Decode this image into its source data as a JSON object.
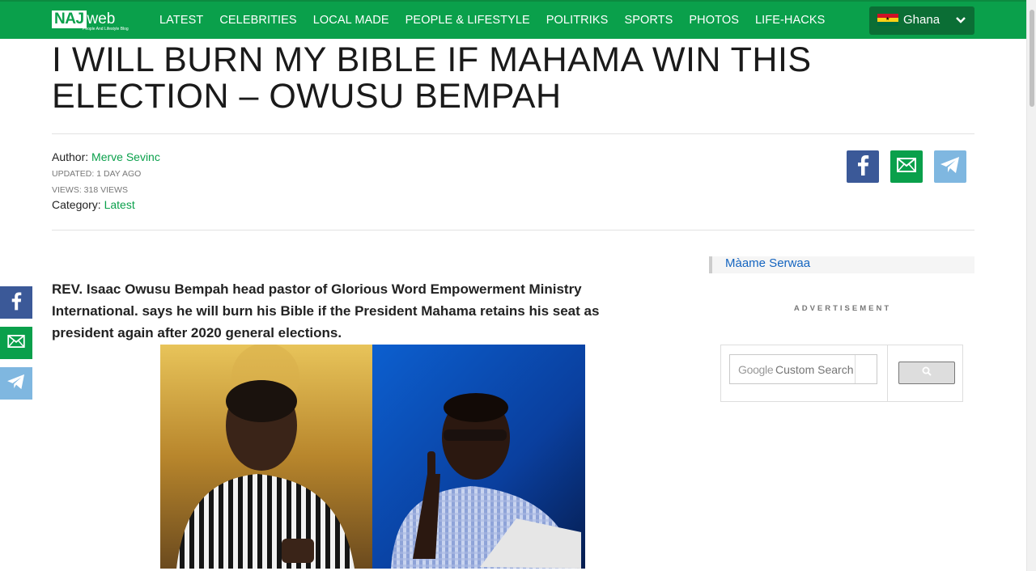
{
  "site": {
    "logo_main": "NAJ",
    "logo_suffix": "web",
    "logo_tagline": "People And Lifestyle Blog"
  },
  "nav": {
    "items": [
      "LATEST",
      "CELEBRITIES",
      "LOCAL MADE",
      "PEOPLE & LIFESTYLE",
      "POLITRIKS",
      "SPORTS",
      "PHOTOS",
      "LIFE-HACKS"
    ],
    "country": "Ghana"
  },
  "article": {
    "title": "I WILL BURN MY BIBLE IF MAHAMA WIN THIS ELECTION – OWUSU BEMPAH",
    "author_label": "Author:",
    "author_name": "Merve Sevinc",
    "updated": "UPDATED: 1 DAY AGO",
    "views": "VIEWS: 318 VIEWS",
    "category_label": "Category:",
    "category_name": "Latest",
    "lead": "REV. Isaac Owusu Bempah head pastor of Glorious Word Empowerment Ministry International. says he will burn his Bible if the President Mahama retains his seat as president again after 2020 general elections."
  },
  "sidebar": {
    "related_link": "Màame Serwaa",
    "ad_label": "ADVERTISEMENT",
    "search_brand": "Google",
    "search_placeholder": "Custom Search"
  },
  "colors": {
    "brand_green": "#0aa04b",
    "facebook": "#3b5998",
    "telegram": "#7fb7e0",
    "link_blue": "#1565c0"
  },
  "icons": [
    "facebook-icon",
    "email-icon",
    "telegram-icon",
    "chevron-down-icon",
    "ghana-flag-icon",
    "search-icon"
  ]
}
